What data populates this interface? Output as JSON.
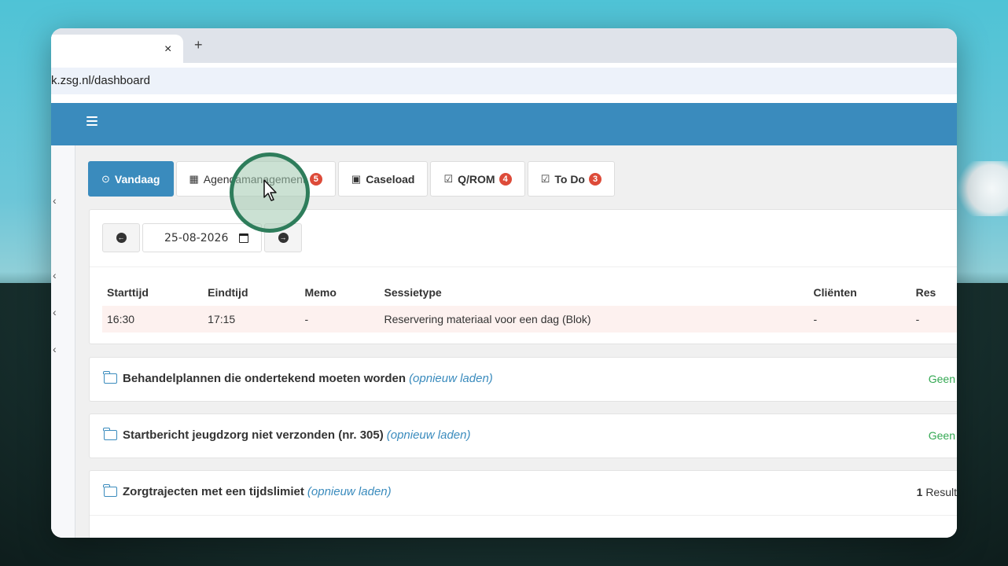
{
  "browser": {
    "url": "k.zsg.nl/dashboard",
    "tab_close": "×",
    "tab_new": "+"
  },
  "sidebar": {
    "arrows": [
      "‹",
      "‹",
      "‹",
      "‹"
    ]
  },
  "tabs": [
    {
      "label": "Vandaag",
      "icon": "clock-icon",
      "badge": ""
    },
    {
      "label": "Agendamanagement",
      "icon": "calendar-icon",
      "badge": "5"
    },
    {
      "label": "Caseload",
      "icon": "id-card-icon",
      "badge": ""
    },
    {
      "label": "Q/ROM",
      "icon": "check-square-icon",
      "badge": "4"
    },
    {
      "label": "To Do",
      "icon": "check-square-icon",
      "badge": "3"
    }
  ],
  "agenda": {
    "date": "25-08-2026",
    "columns": [
      "Starttijd",
      "Eindtijd",
      "Memo",
      "Sessietype",
      "Cliënten",
      "Res"
    ],
    "rows": [
      [
        "16:30",
        "17:15",
        "-",
        "Reservering materiaal voor een dag (Blok)",
        "-",
        "-"
      ]
    ]
  },
  "sections": [
    {
      "title": "Behandelplannen die ondertekend moeten worden",
      "reload": "(opnieuw laden)",
      "status": "Geen"
    },
    {
      "title": "Startbericht jeugdzorg niet verzonden (nr. 305)",
      "reload": "(opnieuw laden)",
      "status": "Geen"
    },
    {
      "title": "Zorgtrajecten met een tijdslimiet",
      "reload": "(opnieuw laden)",
      "result_count": "1",
      "result_label": "Result"
    }
  ],
  "colors": {
    "brand": "#3a8bbd",
    "badge": "#dd4b39",
    "status_ok": "#34a853",
    "cursor_ring": "#2e7d5b"
  }
}
